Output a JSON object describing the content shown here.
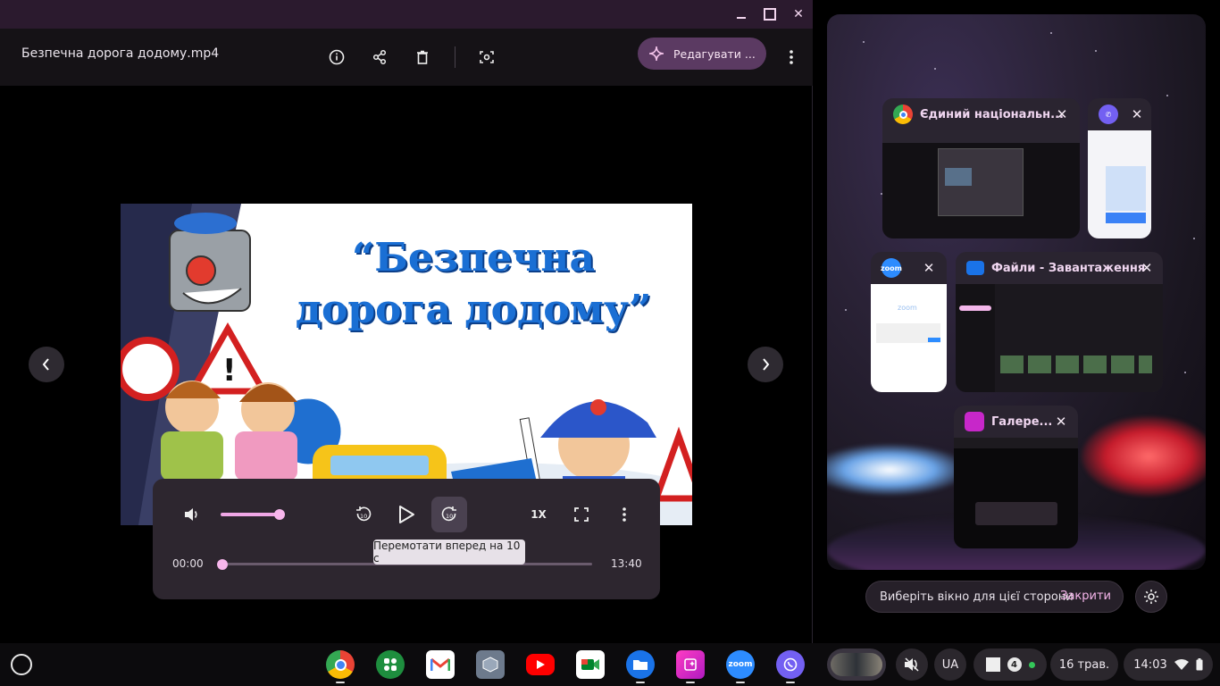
{
  "window": {
    "file_name": "Безпечна дорога додому.mp4",
    "edit_label": "Редагувати ...",
    "minimize_glyph": "",
    "close_glyph": "✕"
  },
  "video": {
    "title_line1": "“Безпечна",
    "title_line2": "дорога додому”"
  },
  "player": {
    "current_time": "00:00",
    "total_time": "13:40",
    "speed_label": "1X",
    "volume_level": 0.8,
    "progress": 0.0,
    "tooltip": "Перемотати вперед на 10 с"
  },
  "overview": {
    "cards": [
      {
        "app": "chrome",
        "title": "Єдиний національн...",
        "icon": "chrome-icon"
      },
      {
        "app": "viber",
        "title": "",
        "icon": "viber-icon"
      },
      {
        "app": "zoom",
        "title": "",
        "icon": "zoom-icon"
      },
      {
        "app": "files",
        "title": "Файли - Завантаження",
        "icon": "folder-icon"
      },
      {
        "app": "gallery",
        "title": "Галере...",
        "icon": "gallery-icon"
      }
    ],
    "zoom_thumb_text": "zoom",
    "prompt": "Виберіть вікно для цієї сторони",
    "close_label": "Закрити"
  },
  "shelf": {
    "apps": [
      "chrome",
      "apps",
      "gmail",
      "cube",
      "youtube",
      "meet",
      "files",
      "gallery",
      "zoom",
      "viber"
    ],
    "zoom_label": "zoom",
    "language": "UA",
    "notification_count": "4",
    "date": "16 трав.",
    "time": "14:03"
  },
  "colors": {
    "accent": "#f7b6ec",
    "title_bar": "#2b1a2e",
    "controls_bg": "#2d262f"
  }
}
